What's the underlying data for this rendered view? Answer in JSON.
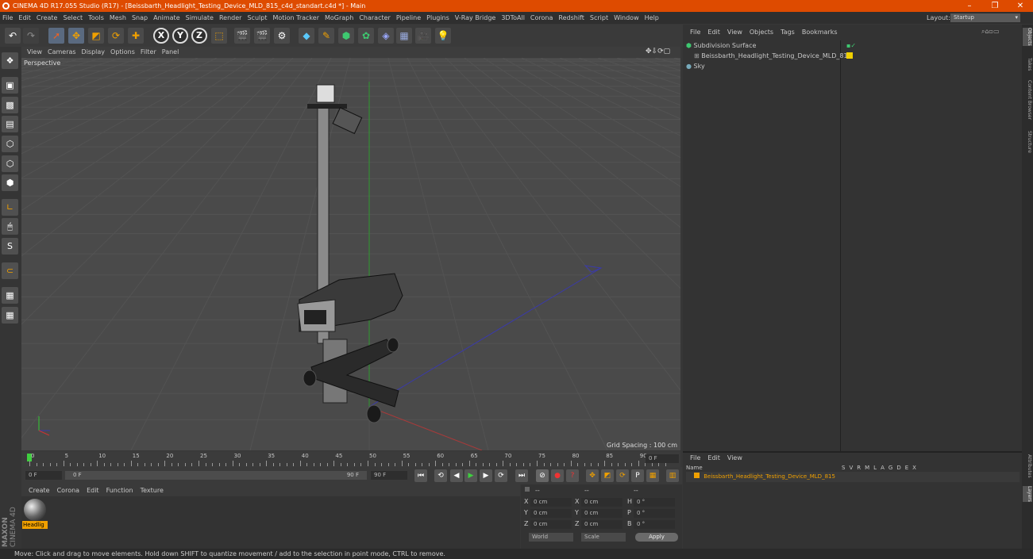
{
  "window": {
    "title": "CINEMA 4D R17.055 Studio (R17) - [Beissbarth_Headlight_Testing_Device_MLD_815_c4d_standart.c4d *] - Main",
    "minimize": "–",
    "restore": "❐",
    "close": "✕"
  },
  "menu": [
    "File",
    "Edit",
    "Create",
    "Select",
    "Tools",
    "Mesh",
    "Snap",
    "Animate",
    "Simulate",
    "Render",
    "Sculpt",
    "Motion Tracker",
    "MoGraph",
    "Character",
    "Pipeline",
    "Plugins",
    "V-Ray Bridge",
    "3DToAll",
    "Corona",
    "Redshift",
    "Script",
    "Window",
    "Help"
  ],
  "layout": {
    "label": "Layout:",
    "value": "Startup"
  },
  "toolbar": {
    "x": "X",
    "y": "Y",
    "z": "Z"
  },
  "viewport": {
    "menu": [
      "View",
      "Cameras",
      "Display",
      "Options",
      "Filter",
      "Panel"
    ],
    "label": "Perspective",
    "grid_spacing": "Grid Spacing : 100 cm"
  },
  "timeline": {
    "ticks": [
      "0",
      "5",
      "10",
      "15",
      "20",
      "25",
      "30",
      "35",
      "40",
      "45",
      "50",
      "55",
      "60",
      "65",
      "70",
      "75",
      "80",
      "85",
      "90"
    ],
    "current": "0 F"
  },
  "transport": {
    "start": "0 F",
    "slider_start": "0 F",
    "slider_end": "90 F",
    "end": "90 F"
  },
  "material": {
    "menu": [
      "Create",
      "Corona",
      "Edit",
      "Function",
      "Texture"
    ],
    "name": "Headlig"
  },
  "coords": {
    "rows": [
      {
        "a": "X",
        "av": "0 cm",
        "b": "X",
        "bv": "0 cm",
        "c": "H",
        "cv": "0 °"
      },
      {
        "a": "Y",
        "av": "0 cm",
        "b": "Y",
        "bv": "0 cm",
        "c": "P",
        "cv": "0 °"
      },
      {
        "a": "Z",
        "av": "0 cm",
        "b": "Z",
        "bv": "0 cm",
        "c": "B",
        "cv": "0 °"
      }
    ],
    "header": [
      "--",
      "--",
      "--"
    ],
    "world": "World",
    "scale": "Scale",
    "apply": "Apply"
  },
  "objects": {
    "menu": [
      "File",
      "Edit",
      "View",
      "Objects",
      "Tags",
      "Bookmarks"
    ],
    "items": [
      "Subdivision Surface",
      "Beissbarth_Headlight_Testing_Device_MLD_815",
      "Sky"
    ]
  },
  "layers": {
    "menu": [
      "File",
      "Edit",
      "View"
    ],
    "header_name": "Name",
    "columns": [
      "S",
      "V",
      "R",
      "M",
      "L",
      "A",
      "G",
      "D",
      "E",
      "X"
    ],
    "item": "Beissbarth_Headlight_Testing_Device_MLD_815"
  },
  "side_tabs": [
    "Objects",
    "Takes",
    "Content Browser",
    "Structure",
    "Attributes",
    "Layers"
  ],
  "brand": {
    "maxon": "MAXON",
    "product": "CINEMA 4D"
  },
  "status": "Move: Click and drag to move elements. Hold down SHIFT to quantize movement / add to the selection in point mode, CTRL to remove.",
  "colors": {
    "accent": "#de4b00",
    "highlight": "#f0a000",
    "viewport": "#4a4a4a"
  }
}
